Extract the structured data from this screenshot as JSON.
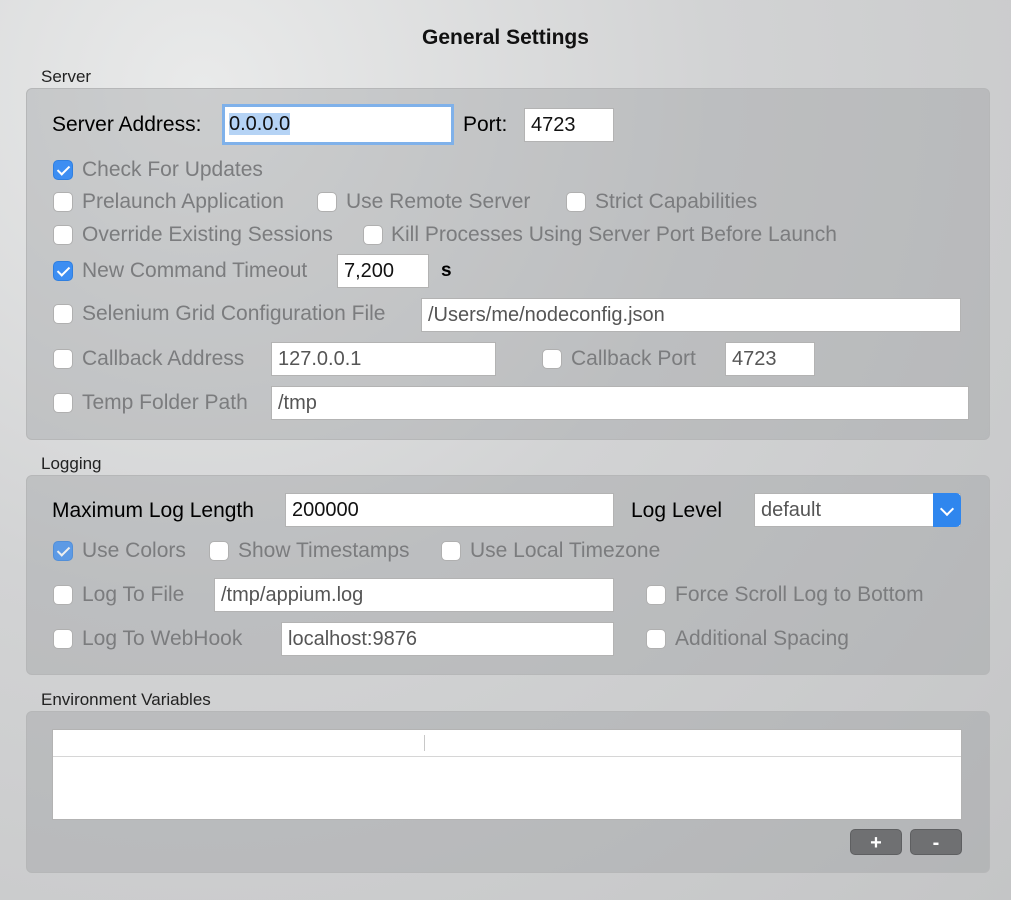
{
  "title": "General Settings",
  "server": {
    "section_label": "Server",
    "address_label": "Server Address:",
    "address_value": "0.0.0.0",
    "port_label": "Port:",
    "port_value": "4723",
    "check_updates": {
      "label": "Check For Updates",
      "checked": true
    },
    "prelaunch": {
      "label": "Prelaunch Application",
      "checked": false
    },
    "remote_server": {
      "label": "Use Remote Server",
      "checked": false
    },
    "strict_caps": {
      "label": "Strict Capabilities",
      "checked": false
    },
    "override_sessions": {
      "label": "Override Existing Sessions",
      "checked": false
    },
    "kill_processes": {
      "label": "Kill Processes Using Server Port Before Launch",
      "checked": false
    },
    "new_command_timeout": {
      "label": "New Command Timeout",
      "checked": true,
      "value": "7,200",
      "unit": "s"
    },
    "selenium_grid": {
      "label": "Selenium Grid Configuration File",
      "checked": false,
      "value": "/Users/me/nodeconfig.json"
    },
    "callback_address": {
      "label": "Callback Address",
      "checked": false,
      "value": "127.0.0.1"
    },
    "callback_port": {
      "label": "Callback Port",
      "checked": false,
      "value": "4723"
    },
    "temp_folder": {
      "label": "Temp Folder Path",
      "checked": false,
      "value": "/tmp"
    }
  },
  "logging": {
    "section_label": "Logging",
    "max_log_label": "Maximum Log Length",
    "max_log_value": "200000",
    "log_level_label": "Log Level",
    "log_level_value": "default",
    "use_colors": {
      "label": "Use Colors",
      "checked": true
    },
    "show_timestamps": {
      "label": "Show Timestamps",
      "checked": false
    },
    "local_timezone": {
      "label": "Use Local Timezone",
      "checked": false
    },
    "log_to_file": {
      "label": "Log To File",
      "checked": false,
      "value": "/tmp/appium.log"
    },
    "force_scroll": {
      "label": "Force Scroll Log to Bottom",
      "checked": false
    },
    "log_to_webhook": {
      "label": "Log To WebHook",
      "checked": false,
      "value": "localhost:9876"
    },
    "additional_spacing": {
      "label": "Additional Spacing",
      "checked": false
    }
  },
  "env": {
    "section_label": "Environment Variables",
    "add_label": "+",
    "remove_label": "-"
  },
  "colors": {
    "accent": "#3d8ef2",
    "focus_ring": "#7fb1ea",
    "selection": "#b5d3f5",
    "button": "#6f7072"
  }
}
